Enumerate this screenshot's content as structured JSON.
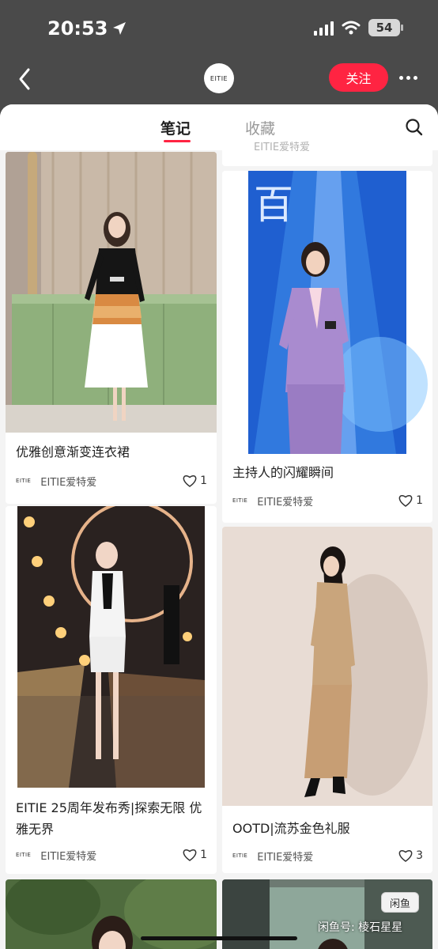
{
  "status": {
    "time": "20:53",
    "battery": "54"
  },
  "header": {
    "brand": "EITIE",
    "follow_label": "关注"
  },
  "tabs": [
    {
      "label": "笔记"
    },
    {
      "label": "收藏"
    }
  ],
  "prev_card": {
    "author": "EITIE爱特爱"
  },
  "cards": [
    {
      "title": "优雅创意渐变连衣裙",
      "author": "EITIE爱特爱",
      "brand": "EITIE",
      "likes": "1"
    },
    {
      "title": "主持人的闪耀瞬间",
      "author": "EITIE爱特爱",
      "brand": "EITIE",
      "likes": "1"
    },
    {
      "title": "EITIE 25周年发布秀|探索无限 优雅无界",
      "author": "EITIE爱特爱",
      "brand": "EITIE",
      "likes": "1"
    },
    {
      "title": "OOTD|流苏金色礼服",
      "author": "EITIE爱特爱",
      "brand": "EITIE",
      "likes": "3"
    }
  ],
  "overlay": {
    "badge": "闲鱼",
    "watermark": "闲鱼号: 棱石星星"
  },
  "colors": {
    "accent": "#ff2442",
    "header_bg": "#4a4a4a"
  },
  "icons": [
    "back-icon",
    "location-arrow-icon",
    "wifi-icon",
    "more-icon",
    "search-icon",
    "heart-icon"
  ]
}
